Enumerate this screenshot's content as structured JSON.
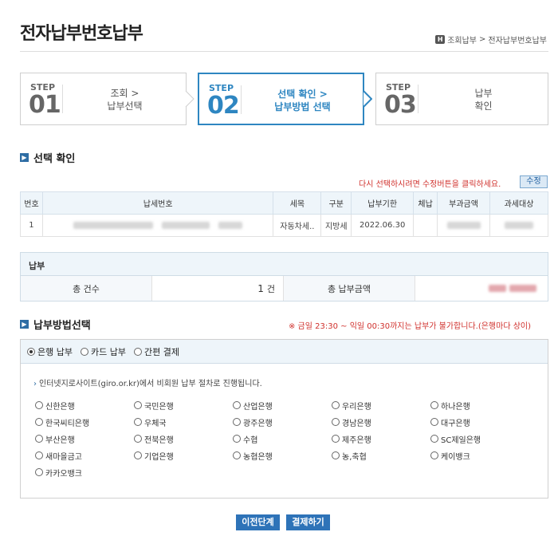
{
  "title": "전자납부번호납부",
  "breadcrumb": {
    "home": "H",
    "items": [
      "조회납부",
      "전자납부번호납부"
    ],
    "sep": ">"
  },
  "steps": [
    {
      "label": "STEP",
      "num": "01",
      "line1": "조회 >",
      "line2": "납부선택"
    },
    {
      "label": "STEP",
      "num": "02",
      "line1": "선택 확인 >",
      "line2": "납부방법 선택"
    },
    {
      "label": "STEP",
      "num": "03",
      "line1": "납부",
      "line2": "확인"
    }
  ],
  "selection": {
    "title": "선택 확인",
    "notice": "다시 선택하시려면 수정버튼을 클릭하세요.",
    "edit_label": "수정",
    "headers": [
      "번호",
      "납세번호",
      "세목",
      "구분",
      "납부기한",
      "체납",
      "부과금액",
      "과세대상"
    ],
    "rows": [
      {
        "no": "1",
        "tax_item": "자동차세..",
        "type": "지방세",
        "due": "2022.06.30",
        "arrears": ""
      }
    ]
  },
  "payment": {
    "title": "납부",
    "count_label": "총 건수",
    "count_value": "1",
    "count_unit": "건",
    "amount_label": "총 납부금액"
  },
  "method": {
    "title": "납부방법선택",
    "notice": "※ 금일 23:30 ~ 익일 00:30까지는 납부가 불가합니다.(은행마다 상이)",
    "tabs": [
      "은행 납부",
      "카드 납부",
      "간편 결제"
    ],
    "giro_note": "인터넷지로사이트(giro.or.kr)에서 비회원 납부 절차로 진행됩니다.",
    "banks": [
      "신한은행",
      "국민은행",
      "산업은행",
      "우리은행",
      "하나은행",
      "한국씨티은행",
      "우체국",
      "광주은행",
      "경남은행",
      "대구은행",
      "부산은행",
      "전북은행",
      "수협",
      "제주은행",
      "SC제일은행",
      "새마을금고",
      "기업은행",
      "농협은행",
      "농,축협",
      "케이뱅크",
      "카카오뱅크"
    ]
  },
  "buttons": {
    "prev": "이전단계",
    "pay": "결제하기"
  },
  "colors": {
    "accent": "#2e86c1",
    "button": "#2e73b8",
    "notice": "#d0312d"
  }
}
